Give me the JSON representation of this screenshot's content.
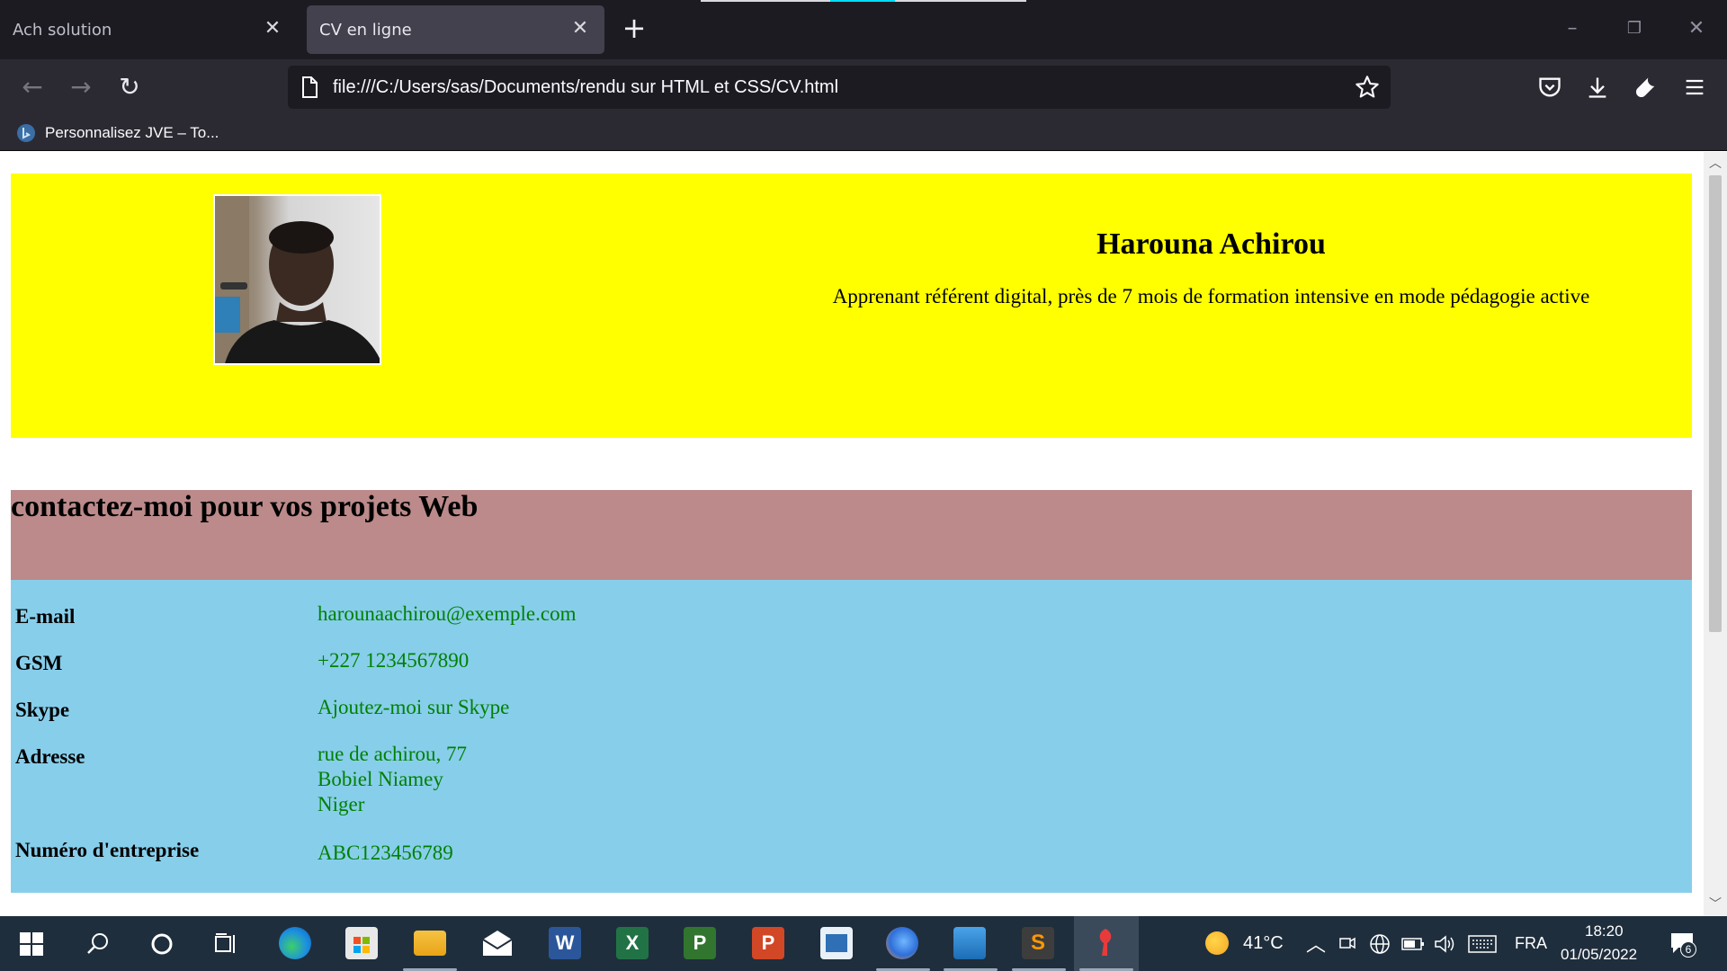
{
  "browser": {
    "tabs": [
      {
        "title": "Ach solution",
        "active": false
      },
      {
        "title": "CV en ligne",
        "active": true
      }
    ],
    "url": "file:///C:/Users/sas/Documents/rendu sur HTML et CSS/CV.html",
    "bookmark": "Personnalisez JVE – To..."
  },
  "cv": {
    "name": "Harouna Achirou",
    "subtitle": "Apprenant référent digital, près de 7 mois de formation intensive en mode pédagogie active",
    "contact_heading": "contactez-moi pour vos projets Web",
    "contacts": [
      {
        "label": "E-mail",
        "lines": [
          "harounaachirou@exemple.com"
        ]
      },
      {
        "label": "GSM",
        "lines": [
          "+227 1234567890"
        ]
      },
      {
        "label": "Skype",
        "lines": [
          "Ajoutez-moi sur Skype"
        ]
      },
      {
        "label": "Adresse",
        "lines": [
          "rue de achirou, 77",
          "Bobiel Niamey",
          "Niger"
        ]
      },
      {
        "label": "Numéro d'entreprise",
        "lines": [
          "ABC123456789"
        ]
      }
    ],
    "colors": {
      "header_bg": "#ffff00",
      "banner_bg": "#bc8a8a",
      "contact_bg": "#87ceeb",
      "value_color": "#008000"
    }
  },
  "taskbar": {
    "temperature": "41°C",
    "language": "FRA",
    "time": "18:20",
    "date": "01/05/2022",
    "notifications": "6",
    "apps": [
      "start-icon",
      "search-icon",
      "cortana-icon",
      "task-view-icon",
      "edge-icon",
      "store-icon",
      "explorer-icon",
      "mail-icon",
      "word-icon",
      "excel-icon",
      "project-icon",
      "powerpoint-icon",
      "publisher-icon",
      "firefox-icon",
      "photos-icon",
      "sublime-icon",
      "paint-icon"
    ]
  }
}
